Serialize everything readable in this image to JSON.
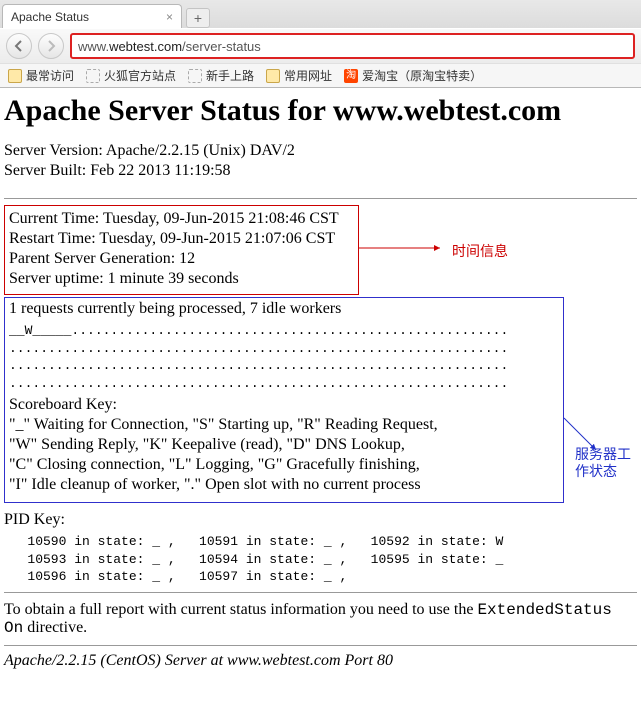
{
  "browser": {
    "tab_title": "Apache Status",
    "url_display_prefix": "www.",
    "url_display_host": "webtest.com",
    "url_display_path": "/server-status",
    "bookmarks": {
      "most_visited": "最常访问",
      "firefox_site": "火狐官方站点",
      "newbie": "新手上路",
      "common": "常用网址",
      "aitaobao": "爱淘宝（原淘宝特卖）"
    }
  },
  "page": {
    "h1": "Apache Server Status for www.webtest.com",
    "server_version": "Server Version: Apache/2.2.15 (Unix) DAV/2",
    "server_built": "Server Built: Feb 22 2013 11:19:58",
    "time": {
      "current": "Current Time: Tuesday, 09-Jun-2015 21:08:46 CST",
      "restart": "Restart Time: Tuesday, 09-Jun-2015 21:07:06 CST",
      "generation": "Parent Server Generation: 12",
      "uptime": "Server uptime:  1 minute 39 seconds"
    },
    "workers_summary": "1 requests currently being processed, 7 idle workers",
    "scoreboard": "__W_____........................................................\n................................................................\n................................................................\n................................................................",
    "score_key_title": "Scoreboard Key:",
    "score_key_lines": [
      "\"_\" Waiting for Connection, \"S\" Starting up, \"R\" Reading Request,",
      "\"W\" Sending Reply, \"K\" Keepalive (read), \"D\" DNS Lookup,",
      "\"C\" Closing connection, \"L\" Logging, \"G\" Gracefully finishing,",
      "\"I\" Idle cleanup of worker, \".\" Open slot with no current process"
    ],
    "pid_key_title": "PID Key:",
    "pid_key_block": "   10590 in state: _ ,   10591 in state: _ ,   10592 in state: W\n   10593 in state: _ ,   10594 in state: _ ,   10595 in state: _\n   10596 in state: _ ,   10597 in state: _ ,",
    "footer_text_prefix": "To obtain a full report with current status information you need to use the ",
    "footer_code": "ExtendedStatus On",
    "footer_text_suffix": " directive.",
    "address": "Apache/2.2.15 (CentOS) Server at www.webtest.com Port 80"
  },
  "annotations": {
    "time_info": "时间信息",
    "worker_state": "服务器工作状态"
  }
}
